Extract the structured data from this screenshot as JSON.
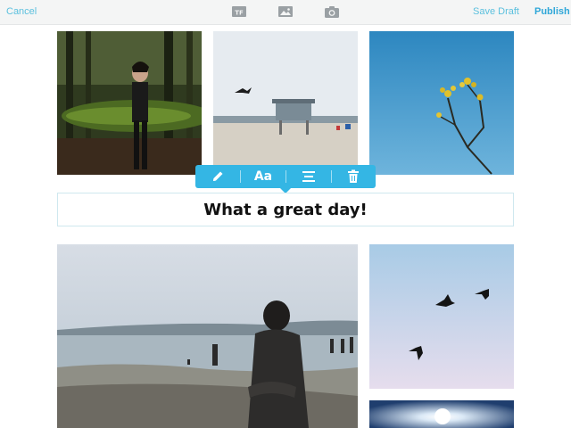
{
  "toolbar": {
    "cancel_label": "Cancel",
    "save_draft_label": "Save Draft",
    "publish_label": "Publish",
    "icons": [
      "text-icon",
      "image-icon",
      "camera-icon"
    ]
  },
  "text_block": {
    "caption": "What a great day!"
  },
  "edit_toolbar": {
    "format_label": "Aa",
    "icons": [
      "pencil-icon",
      "align-center-icon",
      "trash-icon"
    ]
  },
  "colors": {
    "accent": "#34b6e4",
    "link": "#5bc0de",
    "toolbar_bg": "#f4f5f5"
  }
}
